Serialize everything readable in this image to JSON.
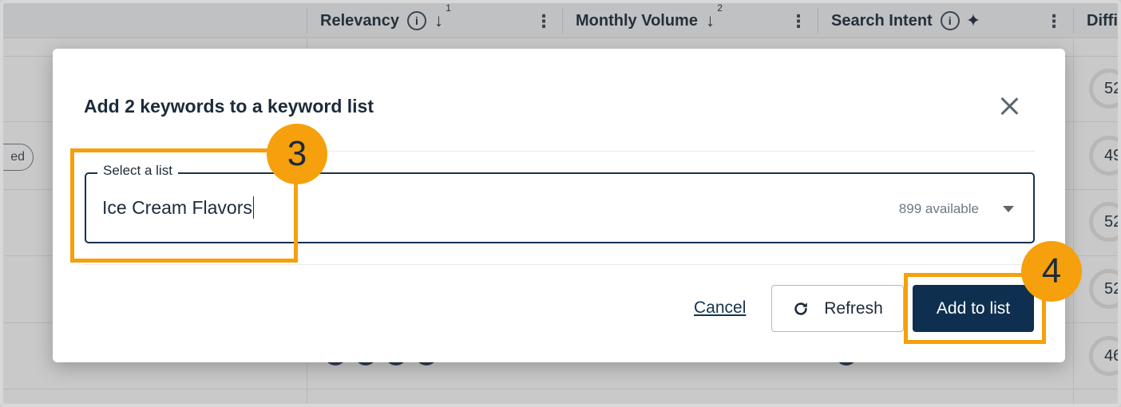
{
  "table": {
    "columns": [
      {
        "label": "Relevancy",
        "sort_rank": "1"
      },
      {
        "label": "Monthly Volume",
        "sort_rank": "2"
      },
      {
        "label": "Search Intent"
      },
      {
        "label": "Diffi"
      }
    ],
    "info_glyph": "i",
    "sort_glyph": "↓",
    "menu_glyph": "⋮",
    "sparkle_glyph": "✦",
    "pill_text": "ed",
    "scores": [
      "52",
      "49",
      "52",
      "52",
      "46"
    ]
  },
  "modal": {
    "title": "Add 2 keywords to a keyword list",
    "select": {
      "legend": "Select a list",
      "value": "Ice Cream Flavors",
      "available": "899 available"
    },
    "cancel_label": "Cancel",
    "refresh_label": "Refresh",
    "add_label": "Add to list"
  },
  "annotations": {
    "step_select": "3",
    "step_add": "4"
  },
  "colors": {
    "highlight": "#f5a00c",
    "primary": "#0f2f50"
  },
  "icons": [
    "info-icon",
    "sort-down-icon",
    "kebab-menu-icon",
    "sparkle-icon",
    "close-icon",
    "dropdown-arrow-icon",
    "refresh-icon"
  ]
}
